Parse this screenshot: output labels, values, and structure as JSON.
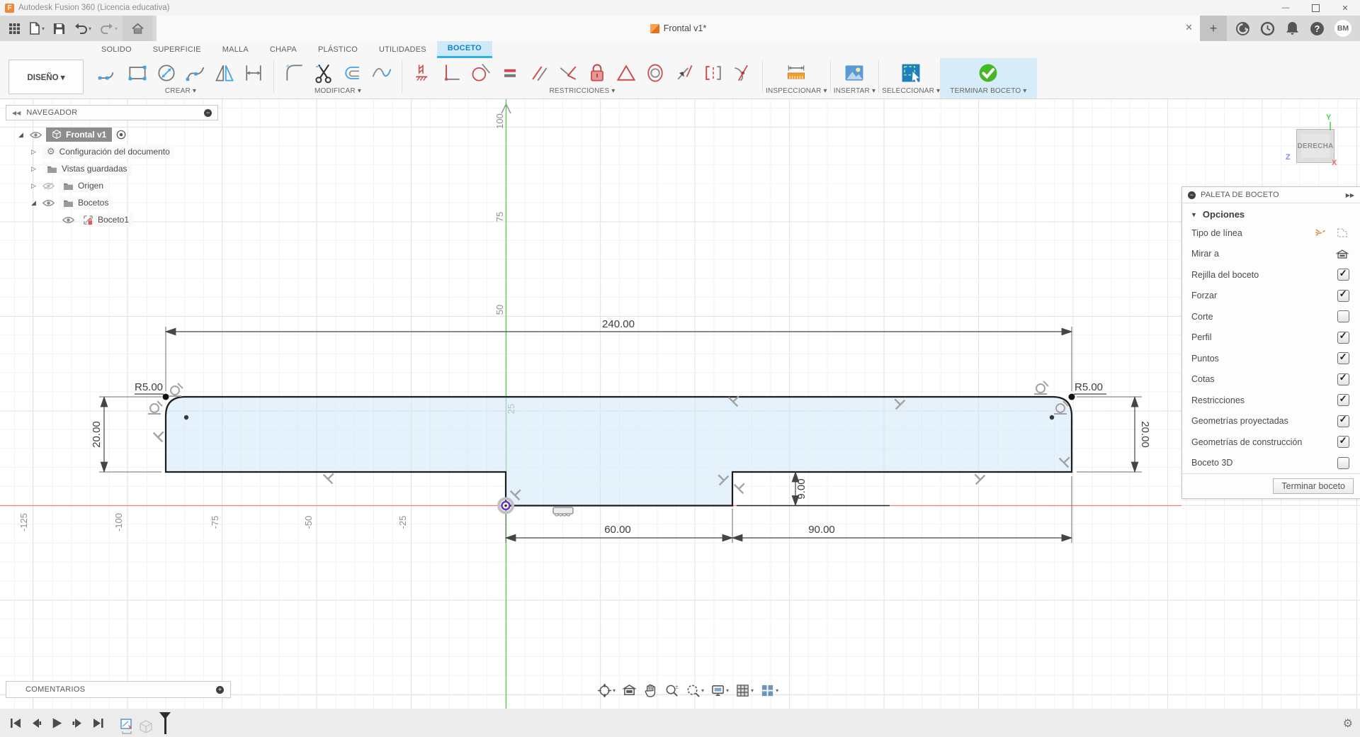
{
  "window": {
    "title": "Autodesk Fusion 360 (Licencia educativa)"
  },
  "tabstrip": {
    "doc_tab": "Frontal v1*",
    "close": "✕",
    "new_tab": "+",
    "avatar": "BM"
  },
  "ribbon": {
    "design_dropdown": "DISEÑO ▾",
    "tabs": [
      {
        "label": "SOLIDO"
      },
      {
        "label": "SUPERFICIE"
      },
      {
        "label": "MALLA"
      },
      {
        "label": "CHAPA"
      },
      {
        "label": "PLÁSTICO"
      },
      {
        "label": "UTILIDADES"
      },
      {
        "label": "BOCETO",
        "active": true
      }
    ],
    "groups": {
      "crear": "CREAR ▾",
      "modificar": "MODIFICAR ▾",
      "restricciones": "RESTRICCIONES ▾",
      "inspeccionar": "INSPECCIONAR ▾",
      "insertar": "INSERTAR ▾",
      "seleccionar": "SELECCIONAR ▾",
      "terminar": "TERMINAR BOCETO ▾"
    }
  },
  "navigator": {
    "collapse": "◀◀",
    "title": "NAVEGADOR",
    "items": [
      {
        "label": "Frontal v1",
        "selected": true
      },
      {
        "label": "Configuración del documento"
      },
      {
        "label": "Vistas guardadas"
      },
      {
        "label": "Origen"
      },
      {
        "label": "Bocetos"
      },
      {
        "label": "Boceto1"
      }
    ]
  },
  "palette": {
    "title": "PALETA DE BOCETO",
    "expand": "▶▶",
    "section": "Opciones",
    "options": [
      {
        "label": "Tipo de línea",
        "control": "linetype"
      },
      {
        "label": "Mirar a",
        "control": "lookat"
      },
      {
        "label": "Rejilla del boceto",
        "control": "checkbox",
        "checked": true
      },
      {
        "label": "Forzar",
        "control": "checkbox",
        "checked": true
      },
      {
        "label": "Corte",
        "control": "checkbox",
        "checked": false
      },
      {
        "label": "Perfil",
        "control": "checkbox",
        "checked": true
      },
      {
        "label": "Puntos",
        "control": "checkbox",
        "checked": true
      },
      {
        "label": "Cotas",
        "control": "checkbox",
        "checked": true
      },
      {
        "label": "Restricciones",
        "control": "checkbox",
        "checked": true
      },
      {
        "label": "Geometrías proyectadas",
        "control": "checkbox",
        "checked": true
      },
      {
        "label": "Geometrías de construcción",
        "control": "checkbox",
        "checked": true
      },
      {
        "label": "Boceto 3D",
        "control": "checkbox",
        "checked": false
      }
    ],
    "button": "Terminar boceto"
  },
  "viewcube": {
    "face": "DERECHA",
    "axis_x": "X",
    "axis_y": "Y",
    "axis_z": "Z"
  },
  "comments": {
    "label": "COMENTARIOS"
  },
  "canvas": {
    "dimensions": {
      "width": "240.00",
      "height_left": "20.00",
      "height_right": "20.00",
      "notch_width": "60.00",
      "right_width": "90.00",
      "step_height": "9.00",
      "fillet_left": "R5.00",
      "fillet_right": "R5.00"
    },
    "y_ticks": [
      "100",
      "75",
      "50",
      "25"
    ],
    "x_ticks": [
      "-125",
      "-100",
      "-75",
      "-50",
      "-25"
    ]
  },
  "colors": {
    "accent_blue": "#1186c4",
    "active_tab_bg": "#cfe9f8",
    "terminar_bg": "#d6ecf8",
    "terminar_check": "#47b825",
    "profile_fill": "#e7f1fa",
    "axis_green": "#56c956",
    "axis_red": "#ef8277",
    "origin_purple": "#6a35c2",
    "constraint_red": "#cc4b4b",
    "constraint_gray": "#9e9e9e",
    "inspect_orange": "#f0a030"
  }
}
